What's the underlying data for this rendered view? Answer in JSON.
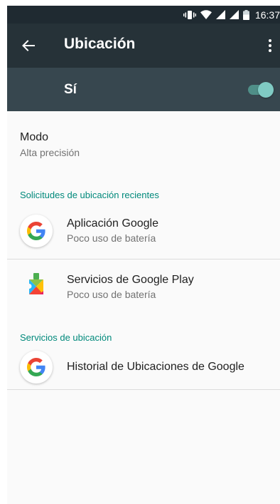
{
  "status_bar": {
    "time": "16:37"
  },
  "app_bar": {
    "title": "Ubicación",
    "back_icon": "arrow-back-icon",
    "menu_icon": "more-vert-icon"
  },
  "master_switch": {
    "label": "Sí",
    "on": true,
    "accent": "#80cbc4"
  },
  "mode": {
    "title": "Modo",
    "summary": "Alta precisión"
  },
  "recent_requests": {
    "header": "Solicitudes de ubicación recientes",
    "apps": [
      {
        "name": "Aplicación Google",
        "summary": "Poco uso de batería",
        "icon": "google-g-icon"
      },
      {
        "name": "Servicios de Google Play",
        "summary": "Poco uso de batería",
        "icon": "google-play-services-icon"
      }
    ]
  },
  "location_services": {
    "header": "Servicios de ubicación",
    "items": [
      {
        "name": "Historial de Ubicaciones de Google",
        "icon": "google-g-icon"
      }
    ]
  },
  "colors": {
    "appbar": "#263238",
    "switch_bar": "#37474f",
    "section_header": "#00897b"
  }
}
